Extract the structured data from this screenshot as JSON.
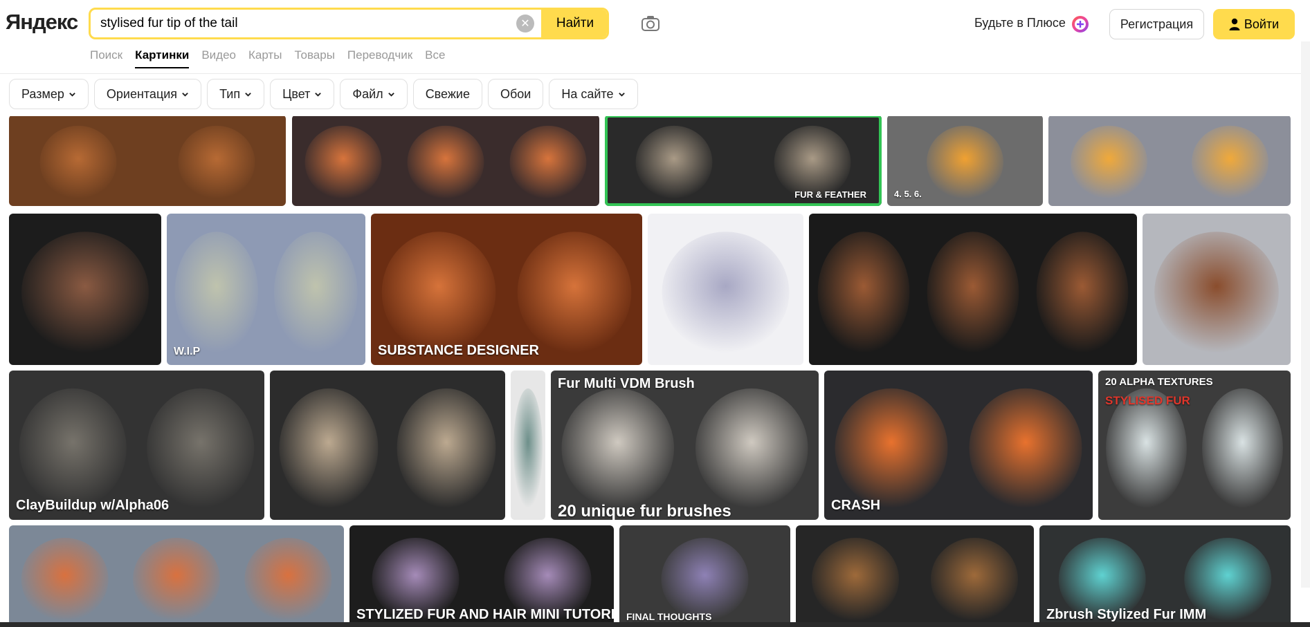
{
  "header": {
    "logo": "Яндекс",
    "search": {
      "value": "stylised fur tip of the tail",
      "button": "Найти"
    },
    "plus_text": "Будьте в Плюсе",
    "register": "Регистрация",
    "login": "Войти",
    "nav": [
      "Поиск",
      "Картинки",
      "Видео",
      "Карты",
      "Товары",
      "Переводчик",
      "Все"
    ],
    "nav_active": "Картинки"
  },
  "filters": [
    {
      "label": "Размер",
      "dropdown": true
    },
    {
      "label": "Ориентация",
      "dropdown": true
    },
    {
      "label": "Тип",
      "dropdown": true
    },
    {
      "label": "Цвет",
      "dropdown": true
    },
    {
      "label": "Файл",
      "dropdown": true
    },
    {
      "label": "Свежие",
      "dropdown": false
    },
    {
      "label": "Обои",
      "dropdown": false
    },
    {
      "label": "На сайте",
      "dropdown": true
    }
  ],
  "tiles": [
    {
      "caption": "",
      "colors": [
        "#6e3f20",
        "#b76a34"
      ]
    },
    {
      "caption": "",
      "colors": [
        "#3a2c2c",
        "#d7743c"
      ]
    },
    {
      "caption": "FUR & FEATHER",
      "colors": [
        "#2a2a2a",
        "#a99a86"
      ],
      "selected": true
    },
    {
      "caption": "4.      5.      6.",
      "colors": [
        "#6c6c6c",
        "#f0a131"
      ]
    },
    {
      "caption": "",
      "colors": [
        "#8c8f9a",
        "#f0a93a"
      ]
    },
    {
      "caption": "",
      "colors": [
        "#1c1c1c",
        "#8a5a42"
      ]
    },
    {
      "caption": "W.I.P",
      "colors": [
        "#8e9ab4",
        "#bfc3ad"
      ]
    },
    {
      "caption": "SUBSTANCE DESIGNER",
      "colors": [
        "#6b2d12",
        "#d6733a"
      ]
    },
    {
      "caption": "",
      "colors": [
        "#f1f1f4",
        "#a8a8c4"
      ]
    },
    {
      "caption": "",
      "colors": [
        "#1a1a1a",
        "#9b5a34"
      ]
    },
    {
      "caption": "",
      "colors": [
        "#b5b7bd",
        "#8a4d2d"
      ]
    },
    {
      "caption": "ClayBuildup w/Alpha06",
      "colors": [
        "#333333",
        "#77736b"
      ]
    },
    {
      "caption": "",
      "colors": [
        "#2c2c2c",
        "#bca990"
      ]
    },
    {
      "caption": "",
      "colors": [
        "#e7e7e7",
        "#6d8f8a"
      ]
    },
    {
      "caption": "Fur Multi VDM Brush",
      "sub": "20 unique fur brushes",
      "colors": [
        "#3a3a3a",
        "#cfc9c0"
      ]
    },
    {
      "caption": "CRASH",
      "colors": [
        "#2b2b2e",
        "#e8722e"
      ]
    },
    {
      "caption": "20 ALPHA TEXTURES",
      "sub": "STYLISED FUR",
      "colors": [
        "#3c3c3c",
        "#d9e2e3"
      ]
    },
    {
      "caption": "",
      "colors": [
        "#7c8897",
        "#d9713f"
      ]
    },
    {
      "caption": "STYLIZED FUR AND HAIR MINI TUTORIAL",
      "colors": [
        "#1d1d1d",
        "#a58bb8"
      ]
    },
    {
      "caption": "FINAL THOUGHTS",
      "colors": [
        "#3a3a3a",
        "#8e81b5"
      ]
    },
    {
      "caption": "",
      "colors": [
        "#262626",
        "#9e6a3a"
      ]
    },
    {
      "caption": "Zbrush Stylized Fur IMM",
      "colors": [
        "#2f3233",
        "#5fd2d1"
      ]
    }
  ]
}
